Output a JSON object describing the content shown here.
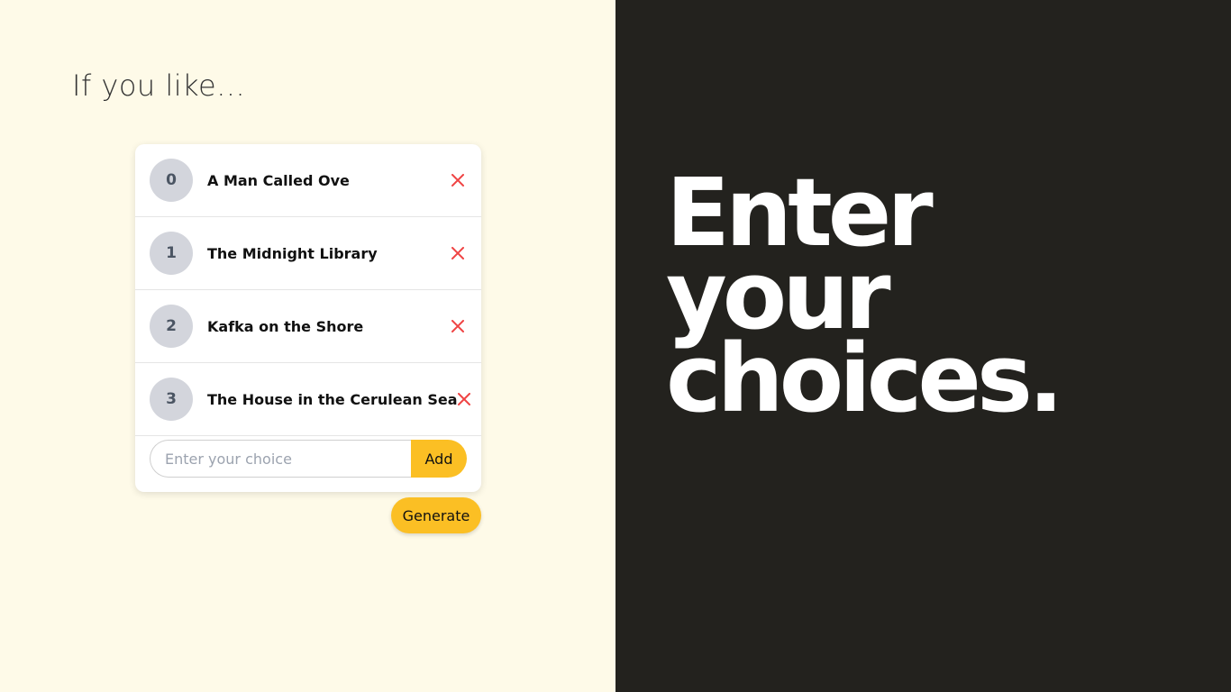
{
  "intro": {
    "text": "If you like..."
  },
  "choices": [
    {
      "index": "0",
      "label": "A Man Called Ove"
    },
    {
      "index": "1",
      "label": "The Midnight Library"
    },
    {
      "index": "2",
      "label": "Kafka on the Shore"
    },
    {
      "index": "3",
      "label": "The House in the Cerulean Sea"
    }
  ],
  "input": {
    "placeholder": "Enter your choice",
    "value": ""
  },
  "buttons": {
    "add_label": "Add",
    "generate_label": "Generate"
  },
  "headline": {
    "line1": "Enter",
    "line2": "your",
    "line3": "choices."
  },
  "icons": {
    "remove": "close-icon"
  },
  "colors": {
    "left_bg": "#fefae8",
    "right_bg": "#23221e",
    "accent": "#fbbf24",
    "remove": "#ef4444",
    "badge": "#d3d5dc"
  }
}
